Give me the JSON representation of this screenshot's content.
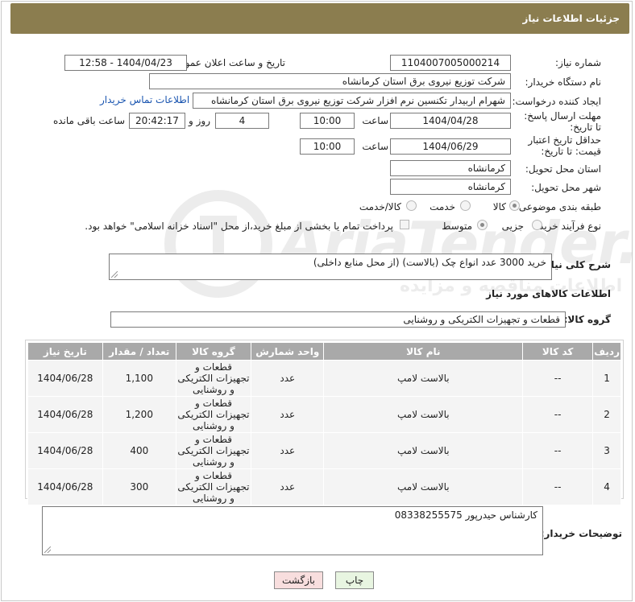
{
  "header": {
    "title": "جزئیات اطلاعات نیاز"
  },
  "watermark": {
    "text": "AriaTender.neT",
    "subtext": "اطلاعات مناقصه و مزایده"
  },
  "form": {
    "need_number": {
      "label": "شماره نیاز:",
      "value": "1104007005000214"
    },
    "announce_datetime": {
      "label": "تاریخ و ساعت اعلان عمومی:",
      "value": "1404/04/23 - 12:58"
    },
    "buyer_org": {
      "label": "نام دستگاه خریدار:",
      "value": "شرکت توزیع نیروی برق استان کرمانشاه"
    },
    "requester": {
      "label": "ایجاد کننده درخواست:",
      "value": "شهرام اربیدار تکنسین نرم افزار شرکت توزیع نیروی برق استان کرمانشاه",
      "contact_link": "اطلاعات تماس خریدار"
    },
    "reply_deadline": {
      "label": "مهلت ارسال پاسخ: تا تاریخ:",
      "date": "1404/04/28",
      "time_label": "ساعت",
      "time": "10:00",
      "days": "4",
      "days_label": "روز و",
      "remaining": "20:42:17",
      "remaining_label": "ساعت باقی مانده"
    },
    "price_validity": {
      "label": "حداقل تاریخ اعتبار قیمت: تا تاریخ:",
      "date": "1404/06/29",
      "time_label": "ساعت",
      "time": "10:00"
    },
    "delivery_province": {
      "label": "استان محل تحویل:",
      "value": "کرمانشاه"
    },
    "delivery_city": {
      "label": "شهر محل تحویل:",
      "value": "کرمانشاه"
    },
    "category": {
      "label": "طبقه بندی موضوعی:",
      "options": [
        "کالا",
        "خدمت",
        "کالا/خدمت"
      ],
      "selected": "کالا"
    },
    "purchase_process": {
      "label": "نوع فرآیند خرید :",
      "options": [
        "جزیی",
        "متوسط"
      ],
      "payment_note": "پرداخت تمام یا بخشی از مبلغ خرید،از محل \"اسناد خزانه اسلامی\" خواهد بود."
    },
    "general_description": {
      "label": "شرح کلی نیاز:",
      "value": "خرید 3000 عدد انواع چک (بالاست) (از محل منابع داخلی)"
    },
    "goods_info_title": "اطلاعات کالاهای مورد نیاز",
    "goods_group": {
      "label": "گروه کالا:",
      "value": "قطعات و تجهیزات الکتریکی و روشنایی"
    }
  },
  "table": {
    "headers": [
      "ردیف",
      "کد کالا",
      "نام کالا",
      "واحد شمارش",
      "گروه کالا",
      "تعداد / مقدار",
      "تاریخ نیاز"
    ],
    "rows": [
      {
        "row": "1",
        "code": "--",
        "name": "بالاست لامپ",
        "unit": "عدد",
        "group": "قطعات و تجهیزات الکتریکی و روشنایی",
        "qty": "1,100",
        "date": "1404/06/28"
      },
      {
        "row": "2",
        "code": "--",
        "name": "بالاست لامپ",
        "unit": "عدد",
        "group": "قطعات و تجهیزات الکتریکی و روشنایی",
        "qty": "1,200",
        "date": "1404/06/28"
      },
      {
        "row": "3",
        "code": "--",
        "name": "بالاست لامپ",
        "unit": "عدد",
        "group": "قطعات و تجهیزات الکتریکی و روشنایی",
        "qty": "400",
        "date": "1404/06/28"
      },
      {
        "row": "4",
        "code": "--",
        "name": "بالاست لامپ",
        "unit": "عدد",
        "group": "قطعات و تجهیزات الکتریکی و روشنایی",
        "qty": "300",
        "date": "1404/06/28"
      }
    ]
  },
  "buyer_notes": {
    "label": "توضیحات خریدار:",
    "value": "کارشناس حیدرپور 08338255575"
  },
  "buttons": {
    "print": "چاپ",
    "back": "بازگشت"
  },
  "colors": {
    "header_bg": "#8b7d4f",
    "table_header_bg": "#a9a9a9",
    "link": "#1a55b0"
  }
}
